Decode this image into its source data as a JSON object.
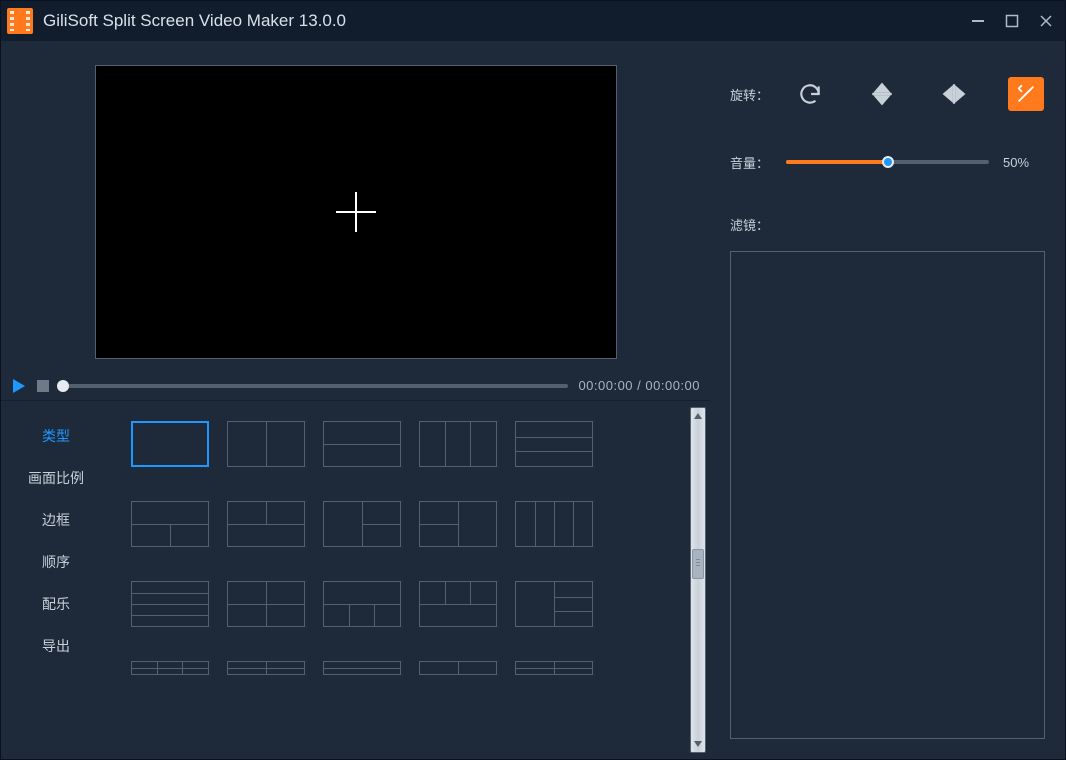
{
  "title": "GiliSoft Split Screen Video Maker 13.0.0",
  "playback": {
    "time_current": "00:00:00",
    "time_total": "00:00:00"
  },
  "tabs": [
    "类型",
    "画面比例",
    "边框",
    "顺序",
    "配乐",
    "导出"
  ],
  "active_tab_index": 0,
  "right": {
    "rotation_label": "旋转：",
    "volume_label": "音量：",
    "volume_percent": "50%",
    "filter_label": "滤镜："
  }
}
